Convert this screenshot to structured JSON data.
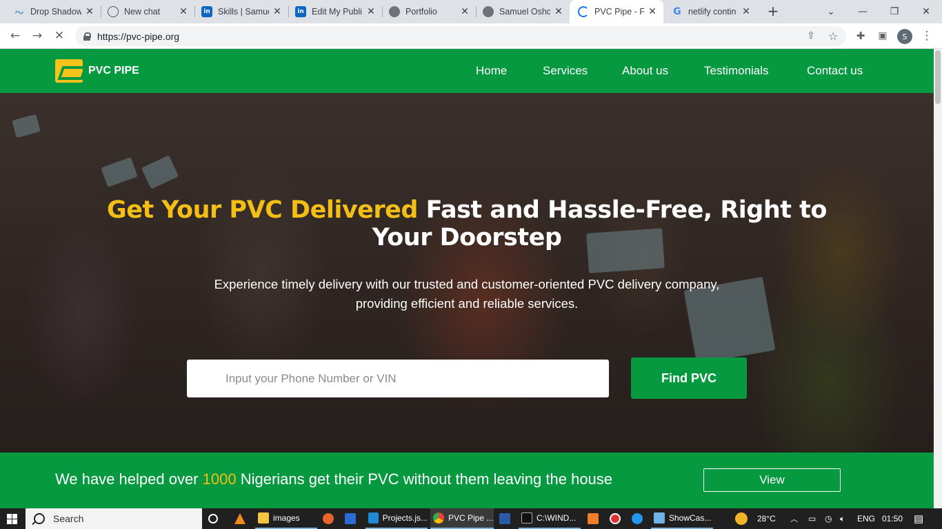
{
  "browser": {
    "tabs": [
      {
        "title": "Drop Shadow",
        "favicon": "wave-icon"
      },
      {
        "title": "New chat",
        "favicon": "openai-icon"
      },
      {
        "title": "Skills | Samue",
        "favicon": "linkedin-icon"
      },
      {
        "title": "Edit My Publi",
        "favicon": "linkedin-icon"
      },
      {
        "title": "Portfolio",
        "favicon": "globe-icon"
      },
      {
        "title": "Samuel Osho",
        "favicon": "globe-icon"
      },
      {
        "title": "PVC Pipe - Fa",
        "favicon": "loading-icon",
        "active": true
      },
      {
        "title": "netlify contin",
        "favicon": "google-icon"
      }
    ],
    "url": "https://pvc-pipe.org",
    "profile_initial": "S"
  },
  "site": {
    "logo_text": "PVC PIPE",
    "nav": [
      "Home",
      "Services",
      "About us",
      "Testimonials",
      "Contact us"
    ],
    "hero": {
      "title_highlight": "Get Your PVC Delivered",
      "title_rest": "Fast and Hassle-Free, Right to Your Doorstep",
      "subtitle": "Experience timely delivery with our trusted and customer-oriented PVC delivery company, providing efficient and reliable services.",
      "search_placeholder": "Input your Phone Number or VIN",
      "search_button": "Find PVC"
    },
    "banner": {
      "text_before": "We have helped over",
      "number": "1000",
      "text_after": "Nigerians get their PVC without them leaving the house",
      "button": "View"
    },
    "colors": {
      "brand_green": "#069940",
      "accent_yellow": "#f3be16"
    }
  },
  "taskbar": {
    "search_label": "Search",
    "items": [
      {
        "label": "images",
        "icon": "folder-icon"
      },
      {
        "label": "Projects.js...",
        "icon": "vscode-icon"
      },
      {
        "label": "PVC Pipe ...",
        "icon": "chrome-icon"
      },
      {
        "label": "C:\\WIND...",
        "icon": "cmd-icon"
      },
      {
        "label": "ShowCas...",
        "icon": "notepad-icon"
      }
    ],
    "weather": "28°C",
    "language": "ENG",
    "time": "01:50"
  }
}
